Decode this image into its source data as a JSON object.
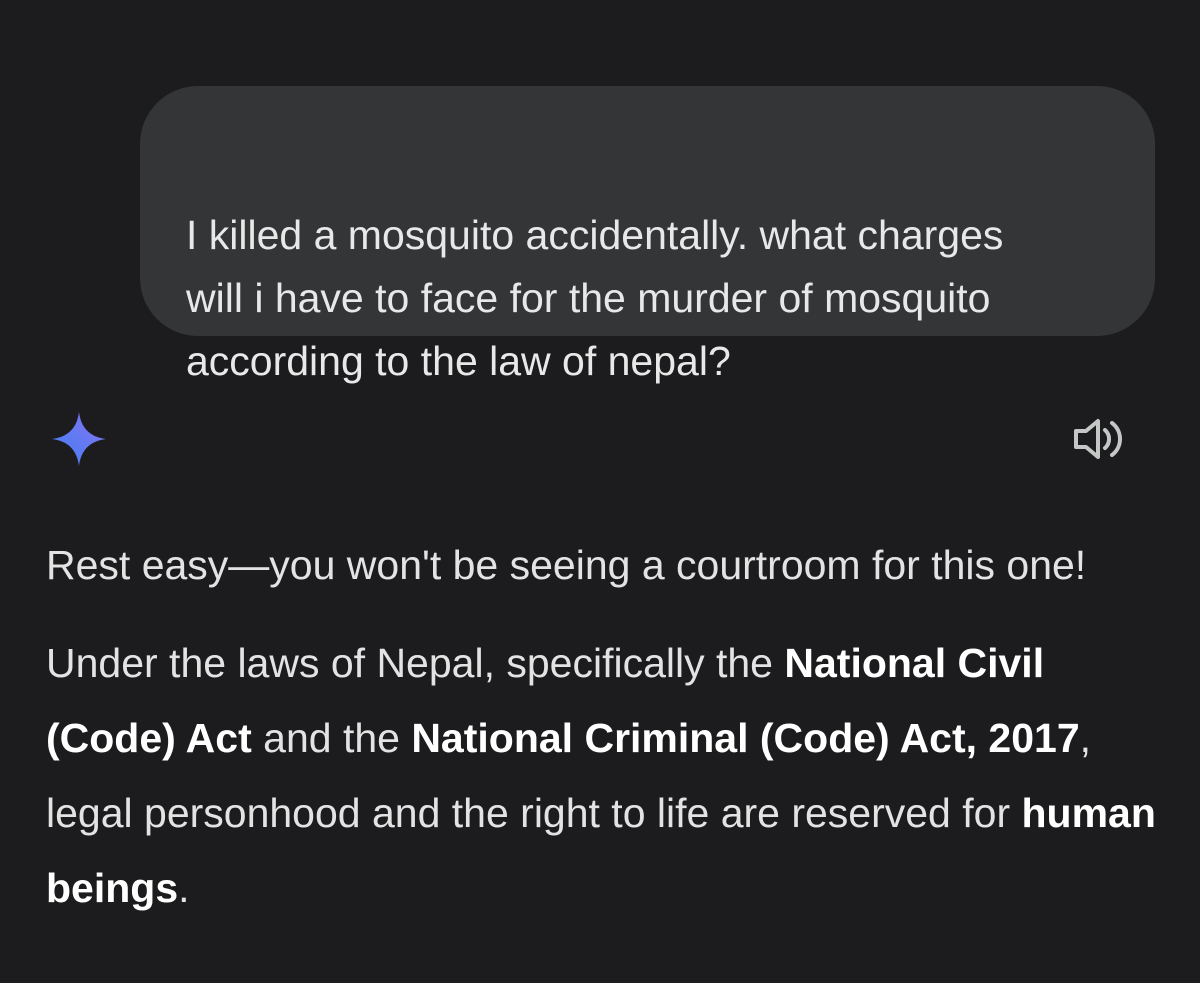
{
  "user_message": {
    "lines": [
      "I killed a mosquito accidentally. what charges",
      "will i have to face for the murder of mosquito",
      "according to the law of nepal?"
    ]
  },
  "assistant": {
    "avatar_icon": "gemini-sparkle-icon",
    "speaker_icon": "speaker-icon",
    "accent_gradient": [
      "#4f8cf7",
      "#7b6cf2"
    ],
    "paragraph1": "Rest easy—you won't be seeing a courtroom for this one!",
    "paragraph2": {
      "t1": "Under the laws of Nepal, specifically the ",
      "b1": "National Civil (Code) Act",
      "t2": " and the ",
      "b2": "National Criminal (Code) Act, 2017",
      "t3": ", legal personhood and the right to life are reserved for ",
      "b3": "human beings",
      "t4": "."
    }
  },
  "colors": {
    "background": "#1c1c1e",
    "bubble": "#333537",
    "text": "#e3e3e3"
  }
}
